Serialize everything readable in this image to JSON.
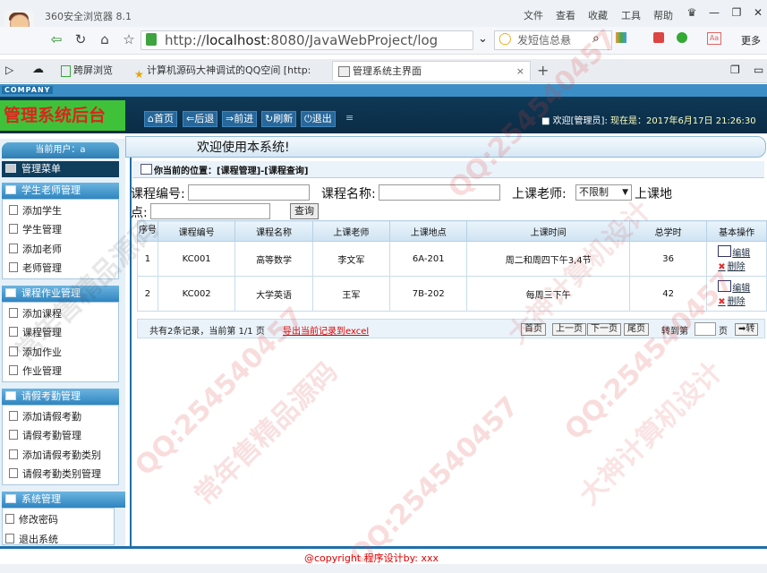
{
  "browser": {
    "title": "360安全浏览器 8.1",
    "menu": [
      "文件",
      "查看",
      "收藏",
      "工具",
      "帮助"
    ],
    "url_prefix": "http://",
    "url_host": "localhost",
    "url_rest": ":8080/JavaWebProject/login/loc",
    "search_placeholder": "发短信总悬",
    "more_label": "更多",
    "tabs": [
      {
        "label": "跨屏浏览"
      },
      {
        "label": "计算机源码大神调试的QQ空间 [http:"
      },
      {
        "label": "管理系统主界面"
      }
    ]
  },
  "header": {
    "company": "COMPANY",
    "title": "管理系统后台",
    "toolbar": [
      "首页",
      "后退",
      "前进",
      "刷新",
      "退出"
    ],
    "welcome": "欢迎[管理员]:",
    "time_label": "现在是：2017年6月17日 21:26:30"
  },
  "sidebar": {
    "current_user": "当前用户：a",
    "menu_title": "管理菜单",
    "groups": [
      {
        "title": "学生老师管理",
        "items": [
          "添加学生",
          "学生管理",
          "添加老师",
          "老师管理"
        ]
      },
      {
        "title": "课程作业管理",
        "items": [
          "添加课程",
          "课程管理",
          "添加作业",
          "作业管理"
        ]
      },
      {
        "title": "请假考勤管理",
        "items": [
          "添加请假考勤",
          "请假考勤管理",
          "添加请假考勤类别",
          "请假考勤类别管理"
        ]
      },
      {
        "title": "系统管理",
        "items": [
          "修改密码",
          "退出系统"
        ]
      }
    ]
  },
  "main": {
    "welcome": "欢迎使用本系统!",
    "location": "你当前的位置：[课程管理]-[课程查询]",
    "search": {
      "course_no_label": "课程编号:",
      "course_name_label": "课程名称:",
      "teacher_label": "上课老师:",
      "teacher_value": "不限制",
      "place_label_1": "上课地",
      "place_label_2": "点:",
      "query_button": "查询"
    },
    "table": {
      "headers": [
        "序号",
        "课程编号",
        "课程名称",
        "上课老师",
        "上课地点",
        "上课时间",
        "总学时",
        "基本操作"
      ],
      "rows": [
        {
          "no": "1",
          "code": "KC001",
          "name": "高等数学",
          "teacher": "李文军",
          "place": "6A-201",
          "time": "周二和周四下午3,4节",
          "hours": "36"
        },
        {
          "no": "2",
          "code": "KC002",
          "name": "大学英语",
          "teacher": "王军",
          "place": "7B-202",
          "time": "每周三下午",
          "hours": "42"
        }
      ],
      "edit_label": "编辑",
      "delete_label": "删除"
    },
    "pager": {
      "info": "共有2条记录，当前第 1/1 页",
      "export": "导出当前记录到excel",
      "first": "首页",
      "prev": "上一页",
      "next": "下一页",
      "last": "尾页",
      "goto_label": "转到第",
      "page_unit": "页",
      "go": "转"
    }
  },
  "footer": {
    "copyright": "@copyright 程序设计by: xxx"
  },
  "watermarks": [
    "QQ:254540457",
    "常年售精品源码",
    "大神计算机设计",
    "QQ:254540457",
    "常年售精品源码",
    "大神计算机设计",
    "QQ:254540457",
    "QQ:254540457"
  ]
}
